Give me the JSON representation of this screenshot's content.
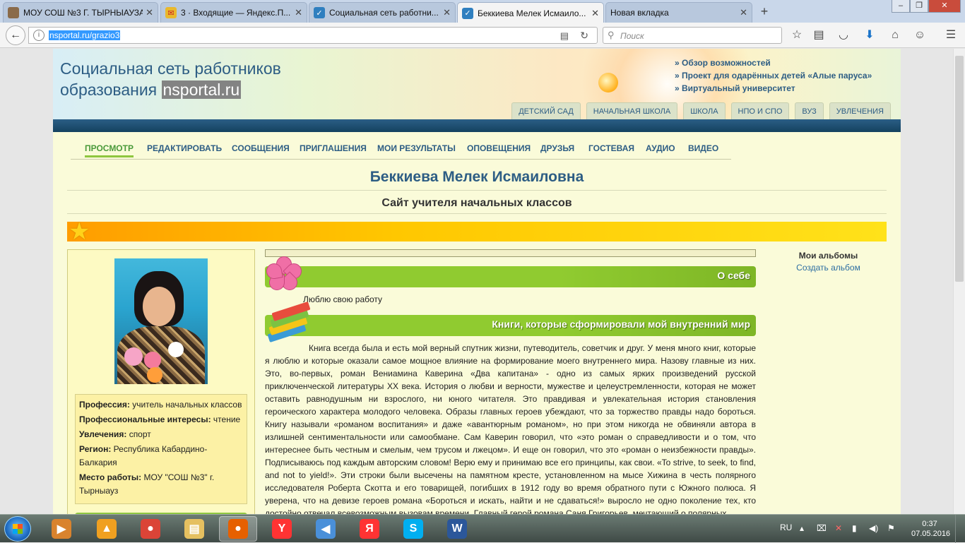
{
  "browser": {
    "tabs": [
      {
        "label": "МОУ СОШ №3 Г. ТЫРНЫАУЗА",
        "icon": "school-favicon-icon",
        "color": "#8a6b4a"
      },
      {
        "label": "3 · Входящие — Яндекс.П...",
        "icon": "yandex-mail-icon",
        "color": "#e94b35"
      },
      {
        "label": "Социальная сеть работни...",
        "icon": "nsportal-check-icon",
        "color": "#2f7fbf"
      },
      {
        "label": "Беккиева Мелек Исмаило...",
        "icon": "nsportal-check-icon",
        "color": "#2f7fbf"
      },
      {
        "label": "Новая вкладка",
        "icon": "",
        "color": ""
      }
    ],
    "url": "nsportal.ru/grazio3",
    "search_placeholder": "Поиск"
  },
  "site": {
    "title_line1": "Социальная сеть работников",
    "title_line2": "образования",
    "domain": "nsportal.ru",
    "promo_links": [
      "Обзор возможностей",
      "Проект для одарённых детей «Алые паруса»",
      "Виртуальный университет"
    ],
    "level_tabs": [
      "ДЕТСКИЙ САД",
      "НАЧАЛЬНАЯ ШКОЛА",
      "ШКОЛА",
      "НПО И СПО",
      "ВУЗ",
      "УВЛЕЧЕНИЯ"
    ]
  },
  "profile_nav": [
    "ПРОСМОТР",
    "РЕДАКТИРОВАТЬ",
    "СООБЩЕНИЯ",
    "ПРИГЛАШЕНИЯ",
    "МОИ РЕЗУЛЬТАТЫ",
    "ОПОВЕЩЕНИЯ",
    "ДРУЗЬЯ",
    "ГОСТЕВАЯ",
    "АУДИО",
    "ВИДЕО"
  ],
  "owner": {
    "name": "Беккиева Мелек Исмаиловна",
    "site_subtitle": "Сайт учителя начальных классов"
  },
  "profile_info": {
    "profession_label": "Профессия:",
    "profession": "учитель начальных классов",
    "interests_label": "Профессиональные интересы:",
    "interests": "чтение",
    "hobbies_label": "Увлечения:",
    "hobbies": "спорт",
    "region_label": "Регион:",
    "region": "Республика Кабардино-Балкария",
    "work_label": "Место работы:",
    "work": "МОУ \"СОШ №3\" г. Тырныауз"
  },
  "sections": {
    "about_title": "О себе",
    "about_text": "Люблю свою работу",
    "books_title": "Книги, которые сформировали мой внутренний мир",
    "books_text": "Книга всегда была и есть мой верный спутник жизни, путеводитель, советчик и друг. У меня много книг, которые я люблю и которые оказали самое мощное влияние на формирование моего внутреннего мира. Назову главные из них. Это, во-первых, роман Вениамина Каверина «Два капитана» - одно из самых ярких произведений русской приключенческой литературы XX века. История о любви и верности, мужестве и целеустремленности, которая не может оставить равнодушным ни взрослого, ни юного читателя. Это правдивая и увлекательная история становления героического характера молодого человека. Образы главных героев убеждают, что за торжество правды надо бороться. Книгу называли «романом воспитания» и даже «авантюрным романом», но при этом никогда не обвиняли автора в излишней сентиментальности или самообмане. Сам Каверин говорил, что «это роман о справедливости и о том, что интереснее быть честным и смелым, чем трусом и лжецом». И еще он говорил, что это «роман о неизбежности правды». Подписываюсь под каждым авторским словом! Верю ему и принимаю все его принципы, как свои. «To strive, to seek, to find, and not to yield!». Эти строки были высечены на памятном кресте, установленном на мысе Хижина в честь полярного исследователя Роберта Скотта и его товарищей, погибших в 1912 году во время обратного пути с Южного полюса. Я уверена, что на девизе героев романа «Бороться и искать, найти и не сдаваться!» выросло не одно поколение тех, кто достойно отвечал всевозможным вызовам времени. Главный герой романа Саня Григорьев, мечтающий о полярных"
  },
  "albums": {
    "title": "Мои альбомы",
    "create": "Создать альбом"
  },
  "taskbar": {
    "apps": [
      {
        "name": "media-player-icon",
        "color": "#d9832e",
        "glyph": "▶"
      },
      {
        "name": "aimp-icon",
        "color": "#f0a020",
        "glyph": "▲"
      },
      {
        "name": "chrome-icon",
        "color": "#db4437",
        "glyph": "●"
      },
      {
        "name": "file-explorer-icon",
        "color": "#e5c060",
        "glyph": "▤"
      },
      {
        "name": "firefox-icon",
        "color": "#e66000",
        "glyph": "●"
      },
      {
        "name": "yandex-browser-icon",
        "color": "#ff3333",
        "glyph": "Y"
      },
      {
        "name": "volume-mixer-icon",
        "color": "#4a90d9",
        "glyph": "◀"
      },
      {
        "name": "yandex-icon",
        "color": "#f33",
        "glyph": "Я"
      },
      {
        "name": "skype-icon",
        "color": "#00aff0",
        "glyph": "S"
      },
      {
        "name": "word-icon",
        "color": "#2b579a",
        "glyph": "W"
      }
    ],
    "lang": "RU",
    "time": "0:37",
    "date": "07.05.2016"
  }
}
